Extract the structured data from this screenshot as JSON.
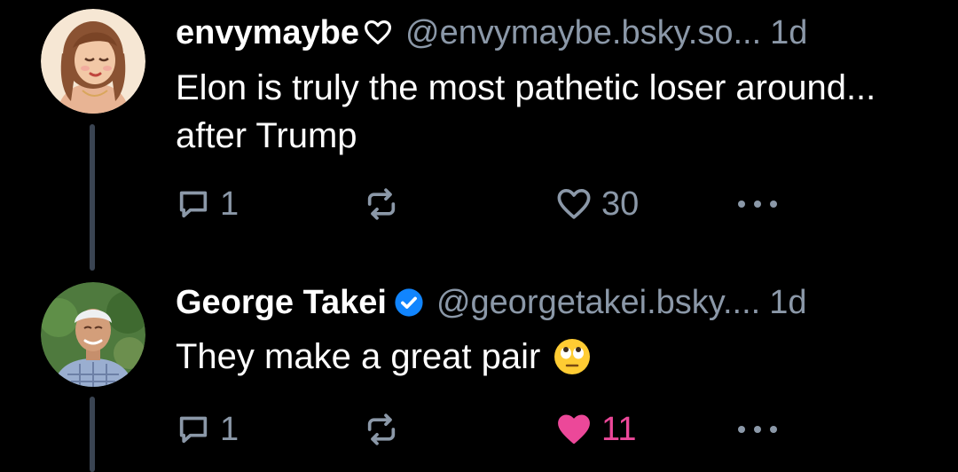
{
  "posts": [
    {
      "display_name": "envymaybe",
      "name_suffix_icon": "heart-outline-icon",
      "handle": "@envymaybe.bsky.so...",
      "time": "1d",
      "text": "Elon is truly the most pathetic loser around... after Trump",
      "reply_count": "1",
      "like_count": "30",
      "liked": false,
      "verified": false
    },
    {
      "display_name": "George Takei",
      "verified": true,
      "handle": "@georgetakei.bsky....",
      "time": "1d",
      "text": "They make a great pair",
      "text_emoji": "face-with-rolling-eyes-icon",
      "reply_count": "1",
      "like_count": "11",
      "liked": true
    }
  ],
  "colors": {
    "background": "#000000",
    "muted_text": "#8b98a8",
    "thread_line": "#3a4452",
    "like_active": "#ec4899",
    "verified": "#1185fe"
  }
}
